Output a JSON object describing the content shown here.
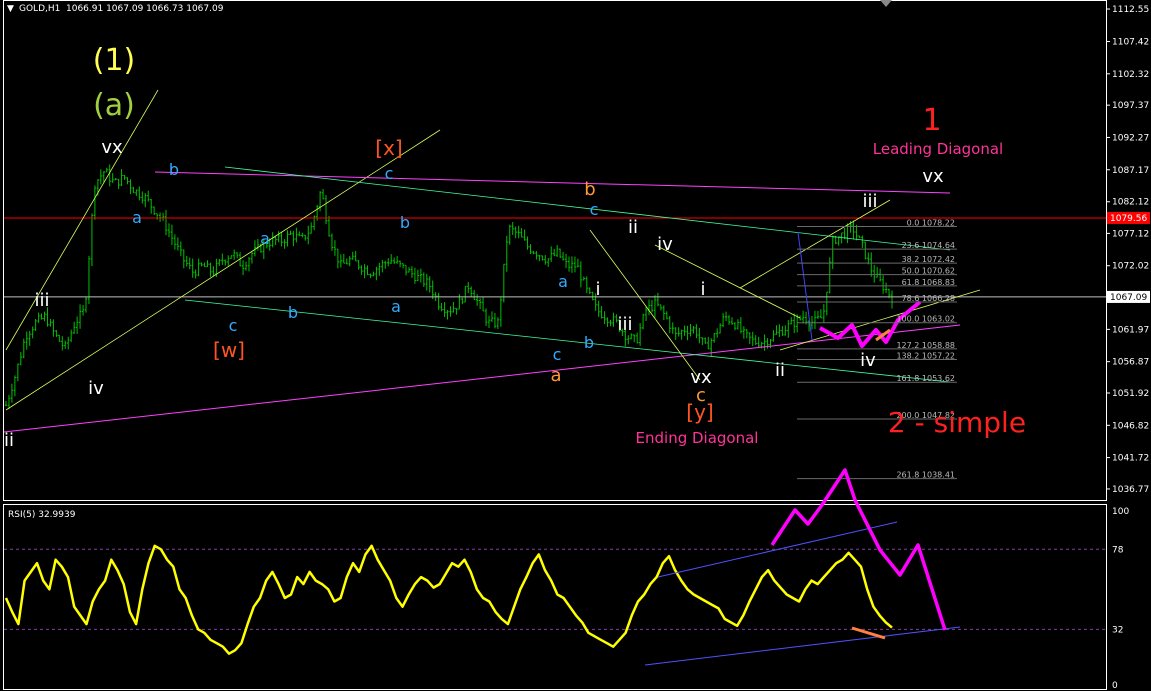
{
  "header": {
    "symbol": "GOLD,H1",
    "ohlc": "1066.91 1067.09 1066.73 1067.09"
  },
  "rsi_header": "RSI(5) 32.9939",
  "colors": {
    "background": "#000000",
    "frame": "#ffffff",
    "candles": "#00c000",
    "rsi_line": "#ffff00",
    "magenta": "#ff00ff",
    "red": "#ff2020",
    "pink_text": "#ff3399",
    "orange": "#ff8040"
  },
  "chart_data": [
    {
      "type": "candlestick",
      "title": "GOLD,H1",
      "y_ticks": [
        "1112.55",
        "1107.42",
        "1102.32",
        "1097.37",
        "1092.27",
        "1087.17",
        "1082.12",
        "1077.12",
        "1072.02",
        "1067.09",
        "1061.97",
        "1056.87",
        "1051.92",
        "1046.82",
        "1041.72",
        "1036.77"
      ],
      "ylim": [
        1035.5,
        1113.5
      ],
      "current_price": "1067.09",
      "red_level_price": "1079.56",
      "close_path": [
        1050,
        1055,
        1061,
        1063,
        1064,
        1061,
        1059,
        1063,
        1065,
        1085,
        1087,
        1085,
        1086,
        1084,
        1083,
        1081,
        1079,
        1076,
        1073,
        1071,
        1072,
        1071,
        1073,
        1074,
        1072,
        1074,
        1075,
        1076,
        1076,
        1077,
        1076,
        1078,
        1084,
        1076,
        1072,
        1073,
        1072,
        1071,
        1072,
        1073,
        1072,
        1071,
        1070,
        1069,
        1066,
        1065,
        1066,
        1069,
        1066,
        1063,
        1063,
        1078,
        1077,
        1075,
        1074,
        1073,
        1074,
        1072,
        1072,
        1068,
        1065,
        1064,
        1063,
        1061,
        1060,
        1065,
        1066,
        1064,
        1061,
        1062,
        1062,
        1059,
        1061,
        1064,
        1063,
        1061,
        1060,
        1060,
        1061,
        1062,
        1063,
        1064,
        1063,
        1064,
        1076,
        1077,
        1078,
        1075,
        1071,
        1069,
        1067
      ],
      "fibonacci": [
        {
          "level": "0.0",
          "price": "1078.22"
        },
        {
          "level": "23.6",
          "price": "1074.64"
        },
        {
          "level": "38.2",
          "price": "1072.42"
        },
        {
          "level": "50.0",
          "price": "1070.62"
        },
        {
          "level": "61.8",
          "price": "1068.83"
        },
        {
          "level": "78.6",
          "price": "1066.28"
        },
        {
          "level": "100.0",
          "price": "1063.02"
        },
        {
          "level": "127.2",
          "price": "1058.88"
        },
        {
          "level": "138.2",
          "price": "1057.22"
        },
        {
          "level": "161.8",
          "price": "1053.62"
        },
        {
          "level": "200.0",
          "price": "1047.82"
        },
        {
          "level": "261.8",
          "price": "1038.41"
        }
      ],
      "annotations": [
        {
          "text": "(1)",
          "color": "#ffff55",
          "size": 30
        },
        {
          "text": "(a)",
          "color": "#a0d040",
          "size": 30
        },
        {
          "text": "vx",
          "color": "#ffffff",
          "size": 18
        },
        {
          "text": "iii",
          "color": "#ffffff",
          "size": 18
        },
        {
          "text": "iv",
          "color": "#ffffff",
          "size": 18
        },
        {
          "text": "ii",
          "color": "#ffffff",
          "size": 18
        },
        {
          "text": "a",
          "color": "#33aaff",
          "size": 16
        },
        {
          "text": "b",
          "color": "#33aaff",
          "size": 16
        },
        {
          "text": "a",
          "color": "#33aaff",
          "size": 16
        },
        {
          "text": "c",
          "color": "#33aaff",
          "size": 16
        },
        {
          "text": "[w]",
          "color": "#ff5522",
          "size": 20
        },
        {
          "text": "b",
          "color": "#33aaff",
          "size": 16
        },
        {
          "text": "[x]",
          "color": "#ff5522",
          "size": 20
        },
        {
          "text": "c",
          "color": "#33aaff",
          "size": 16
        },
        {
          "text": "b",
          "color": "#33aaff",
          "size": 16
        },
        {
          "text": "a",
          "color": "#33aaff",
          "size": 16
        },
        {
          "text": "b",
          "color": "#ff9933",
          "size": 18
        },
        {
          "text": "c",
          "color": "#33aaff",
          "size": 16
        },
        {
          "text": "ii",
          "color": "#ffffff",
          "size": 18
        },
        {
          "text": "iv",
          "color": "#ffffff",
          "size": 18
        },
        {
          "text": "a",
          "color": "#33aaff",
          "size": 16
        },
        {
          "text": "i",
          "color": "#ffffff",
          "size": 18
        },
        {
          "text": "iii",
          "color": "#ffffff",
          "size": 18
        },
        {
          "text": "c",
          "color": "#33aaff",
          "size": 16
        },
        {
          "text": "b",
          "color": "#33aaff",
          "size": 16
        },
        {
          "text": "a",
          "color": "#ff9933",
          "size": 18
        },
        {
          "text": "vx",
          "color": "#ffffff",
          "size": 18
        },
        {
          "text": "c",
          "color": "#ff9933",
          "size": 18
        },
        {
          "text": "[y]",
          "color": "#ff5522",
          "size": 20
        },
        {
          "text": "Ending Diagonal",
          "color": "#ff3399",
          "size": 15
        },
        {
          "text": "i",
          "color": "#ffffff",
          "size": 18
        },
        {
          "text": "ii",
          "color": "#ffffff",
          "size": 18
        },
        {
          "text": "1",
          "color": "#ff2020",
          "size": 30
        },
        {
          "text": "Leading Diagonal",
          "color": "#ff3399",
          "size": 15
        },
        {
          "text": "vx",
          "color": "#ffffff",
          "size": 18
        },
        {
          "text": "iii",
          "color": "#ffffff",
          "size": 18
        },
        {
          "text": "iv",
          "color": "#ffffff",
          "size": 18
        },
        {
          "text": "2 - simple",
          "color": "#ff2020",
          "size": 28
        }
      ]
    },
    {
      "type": "line",
      "title": "RSI(5) 32.9939",
      "y_ticks": [
        "100",
        "78",
        "32",
        "0"
      ],
      "ylim": [
        0,
        100
      ],
      "levels": [
        78,
        32
      ],
      "series": [
        {
          "values": [
            50,
            42,
            35,
            60,
            65,
            70,
            60,
            55,
            72,
            68,
            62,
            45,
            40,
            35,
            48,
            55,
            60,
            72,
            66,
            58,
            42,
            35,
            55,
            70,
            80,
            78,
            72,
            68,
            55,
            50,
            40,
            32,
            30,
            26,
            24,
            22,
            18,
            20,
            24,
            35,
            45,
            50,
            60,
            65,
            58,
            50,
            52,
            62,
            58,
            65,
            60,
            58,
            55,
            48,
            50,
            62,
            70,
            65,
            75,
            80,
            72,
            66,
            60,
            50,
            45,
            52,
            58,
            62,
            60,
            56,
            58,
            64,
            70,
            68,
            72,
            65,
            55,
            50,
            48,
            42,
            38,
            35,
            45,
            55,
            62,
            70,
            75,
            66,
            60,
            52,
            50,
            45,
            40,
            36,
            30,
            28,
            26,
            24,
            22,
            26,
            30,
            40,
            48,
            52,
            58,
            62,
            70,
            74,
            66,
            60,
            55,
            52,
            50,
            48,
            46,
            44,
            38,
            36,
            34,
            40,
            48,
            55,
            62,
            66,
            60,
            56,
            52,
            50,
            48,
            55,
            60,
            58,
            62,
            66,
            70,
            72,
            76,
            72,
            68,
            55,
            45,
            40,
            36,
            33
          ]
        }
      ]
    }
  ]
}
